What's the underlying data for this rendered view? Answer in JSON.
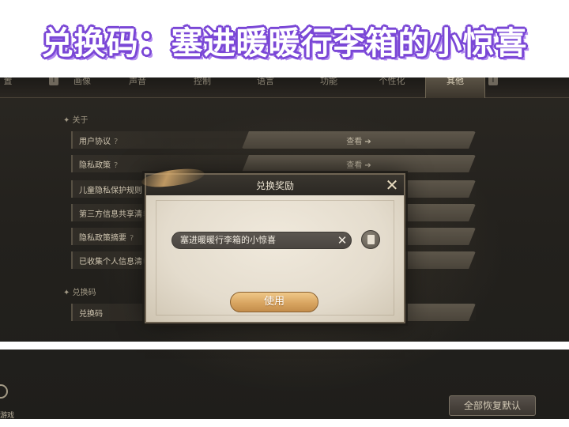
{
  "banner": {
    "title": "兑换码：塞进暖暖行李箱的小惊喜"
  },
  "tabs": [
    {
      "label": "置",
      "active": false
    },
    {
      "label": "画像",
      "active": false
    },
    {
      "label": "声音",
      "active": false
    },
    {
      "label": "控制",
      "active": false
    },
    {
      "label": "语言",
      "active": false
    },
    {
      "label": "功能",
      "active": false
    },
    {
      "label": "个性化",
      "active": false
    },
    {
      "label": "其他",
      "active": true
    }
  ],
  "sections": {
    "about": {
      "header": "✦ 关于",
      "rows": [
        {
          "label": "用户协议",
          "help": "?",
          "button": "查看 ➔"
        },
        {
          "label": "隐私政策",
          "help": "?",
          "button": "查看 ➔"
        },
        {
          "label": "儿童隐私保护规则",
          "help": "",
          "button": ""
        },
        {
          "label": "第三方信息共享清单",
          "help": "",
          "button": ""
        },
        {
          "label": "隐私政策摘要",
          "help": "?",
          "button": ""
        },
        {
          "label": "已收集个人信息清单",
          "help": "",
          "button": ""
        }
      ]
    },
    "redeem": {
      "header": "✦ 兑换码",
      "rows": [
        {
          "label": "兑换码",
          "help": "",
          "button": ""
        }
      ]
    }
  },
  "footer": {
    "reset_label": "全部恢复默认",
    "left_caption": "游戏"
  },
  "modal": {
    "title": "兑换奖励",
    "code_value": "塞进暖暖行李箱的小惊喜",
    "clear_glyph": "✕",
    "close_glyph": "✕",
    "use_label": "使用"
  }
}
